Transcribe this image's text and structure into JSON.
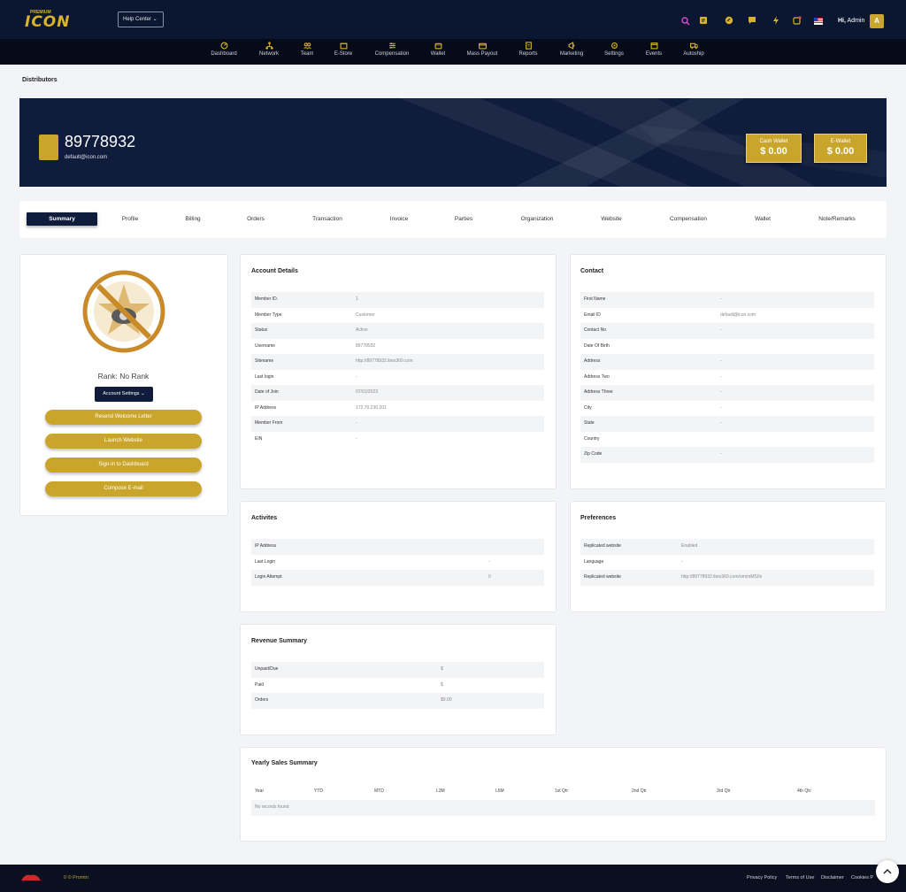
{
  "header": {
    "logo_tag": "PREMIUM",
    "logo_text": "ICON",
    "help_label": "Help Center",
    "greeting": "Hi,",
    "user": "Admin",
    "avatar_letter": "A",
    "icons": [
      "search-icon",
      "notes-icon",
      "gauge-icon",
      "chat-icon",
      "bolt-icon",
      "notification-icon",
      "us-flag-icon"
    ]
  },
  "nav": [
    "Dashboard",
    "Network",
    "Team",
    "E-Store",
    "Compensation",
    "Wallet",
    "Mass Payout",
    "Reports",
    "Marketing",
    "Settings",
    "Events",
    "Autoship"
  ],
  "breadcrumb": "Distributors",
  "profile": {
    "id": "89778932",
    "email": "default@icon.com",
    "cash_wallet_label": "Cash Wallet",
    "cash_wallet_value": "$ 0.00",
    "ewallet_label": "E-Wallet",
    "ewallet_value": "$ 0.00"
  },
  "tabs": [
    "Summary",
    "Profile",
    "Billing",
    "Orders",
    "Transaction",
    "Invoice",
    "Parties",
    "Organization",
    "Website",
    "Compensation",
    "Wallet",
    "Note/Remarks"
  ],
  "left_card": {
    "rank": "Rank: No Rank",
    "account_settings": "Account Settings",
    "buttons": [
      "Resend Welcome Letter",
      "Launch Website",
      "Sign-in to Dashboard",
      "Compose E-mail"
    ]
  },
  "account_details": {
    "title": "Account Details",
    "rows": [
      [
        "Member ID.",
        "1"
      ],
      [
        "Member Type",
        "Customer"
      ],
      [
        "Status",
        "Active"
      ],
      [
        "Username",
        "89778932"
      ],
      [
        "Sitename",
        "http://89778932.ibex360.com"
      ],
      [
        "Last login",
        "-"
      ],
      [
        "Date of Join",
        "07/01/2023"
      ],
      [
        "IP Address",
        "172.70.230.201"
      ],
      [
        "Member From",
        "-"
      ],
      [
        "EIN",
        "-"
      ]
    ]
  },
  "contact": {
    "title": "Contact",
    "rows": [
      [
        "First Name",
        "-"
      ],
      [
        "Email ID",
        "default@icon.com"
      ],
      [
        "Contact No",
        "-"
      ],
      [
        "Date Of Birth",
        ""
      ],
      [
        "Address",
        "-"
      ],
      [
        "Address Two",
        "-"
      ],
      [
        "Address Three",
        "-"
      ],
      [
        "City",
        "-"
      ],
      [
        "State",
        "-"
      ],
      [
        "Country",
        ""
      ],
      [
        "Zip Code",
        "-"
      ]
    ]
  },
  "activities": {
    "title": "Activites",
    "rows": [
      [
        "IP Address",
        ""
      ],
      [
        "Last Login",
        "-"
      ],
      [
        "Login Attempt",
        "0"
      ]
    ]
  },
  "preferences": {
    "title": "Preferences",
    "rows": [
      [
        "Replicated website",
        "Enabled"
      ],
      [
        "Language",
        "-"
      ],
      [
        "Replicated website",
        "http://89778932.ibex360.com/om/mMS0x"
      ]
    ]
  },
  "revenue": {
    "title": "Revenue Summary",
    "rows": [
      [
        "Unpaid/Due",
        "$"
      ],
      [
        "Paid",
        "$"
      ],
      [
        "Orders",
        "$0.00"
      ]
    ]
  },
  "yearly": {
    "title": "Yearly Sales Summary",
    "columns": [
      "Year",
      "YTD",
      "MTD",
      "L3M",
      "L6M",
      "1st Qtr",
      "2nd Qtr",
      "3rd Qtr",
      "4th Qtr"
    ],
    "empty": "No records found"
  },
  "footer": {
    "copyright": "0 © Promtn",
    "links": [
      "Privacy Policy",
      "Terms of Use",
      "Disclaimer",
      "Cookies P"
    ]
  },
  "colors": {
    "navy": "#0f1c3c",
    "gold": "#c9a62b",
    "topbar": "#0b1730"
  }
}
